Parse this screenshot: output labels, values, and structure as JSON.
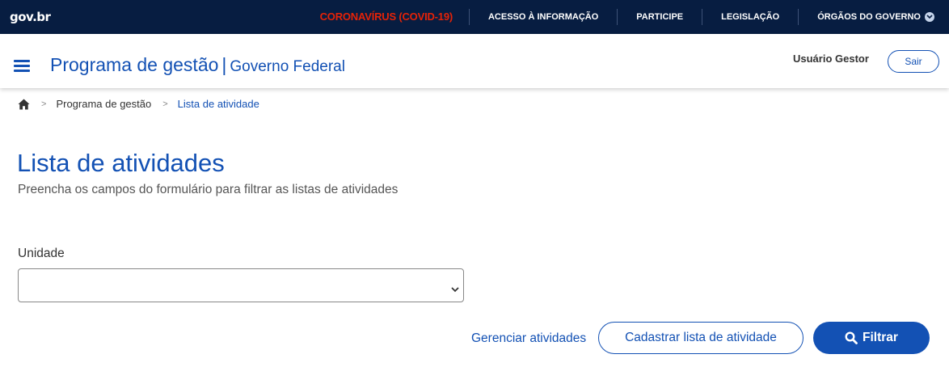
{
  "govbar": {
    "logo": "gov.br",
    "links": {
      "covid": "CORONAVÍRUS (COVID-19)",
      "acesso": "ACESSO À INFORMAÇÃO",
      "participe": "PARTICIPE",
      "legislacao": "LEGISLAÇÃO",
      "orgaos": "ÓRGÃOS DO GOVERNO"
    },
    "icons": {
      "orgaos_dropdown": "chevron-down-icon"
    }
  },
  "header": {
    "title": "Programa de gestão",
    "separator": "|",
    "subtitle": "Governo Federal",
    "user_name": "Usuário Gestor",
    "logout_label": "Sair",
    "icons": {
      "menu": "hamburger-menu-icon"
    }
  },
  "breadcrumb": {
    "home_icon": "home-icon",
    "separator": ">",
    "items": [
      "Programa de gestão",
      "Lista de atividade"
    ]
  },
  "main": {
    "title": "Lista de atividades",
    "subtitle": "Preencha os campos do formulário para filtrar as listas de atividades",
    "unidade_label": "Unidade",
    "unidade_value": "",
    "manage_link": "Gerenciar atividades",
    "register_button": "Cadastrar lista de atividade",
    "filter_button": "Filtrar"
  },
  "colors": {
    "govbar_bg": "#071d41",
    "primary": "#1351b4",
    "covid": "#e52207"
  }
}
